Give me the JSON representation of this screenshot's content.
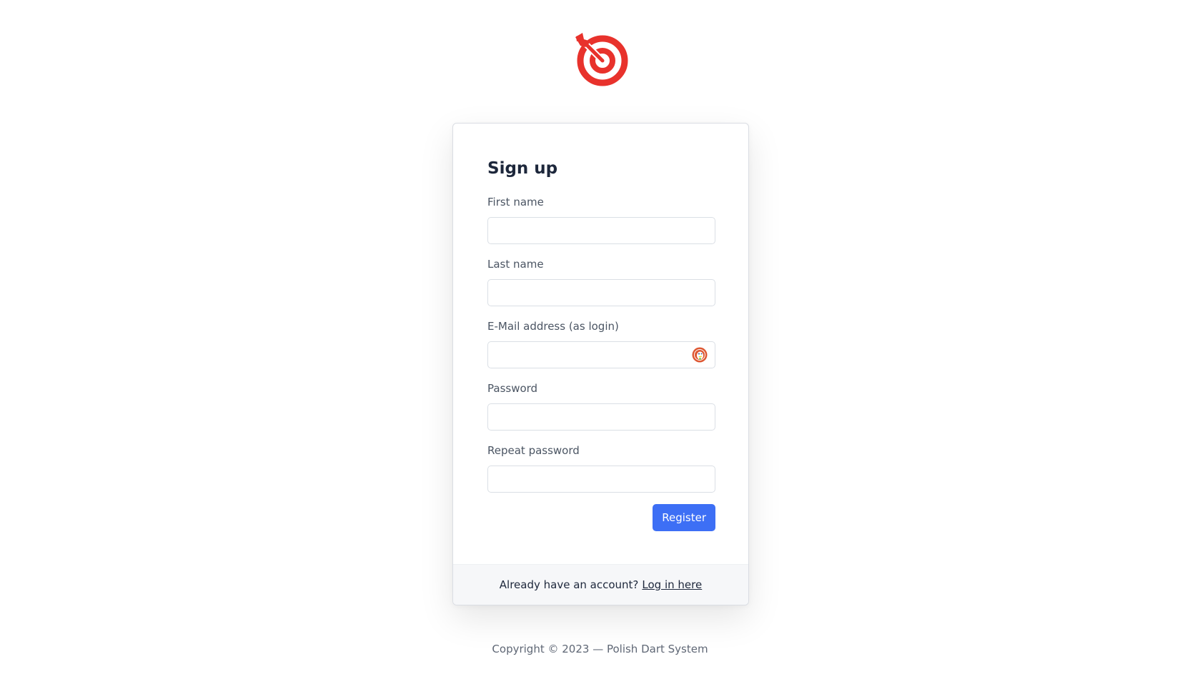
{
  "brand": {
    "logo_icon": "dart-target-icon",
    "accent_color": "#e8322c"
  },
  "form": {
    "title": "Sign up",
    "fields": [
      {
        "label": "First name",
        "value": "",
        "placeholder": ""
      },
      {
        "label": "Last name",
        "value": "",
        "placeholder": ""
      },
      {
        "label": "E-Mail address (as login)",
        "value": "",
        "placeholder": "",
        "autofill_icon": "duckduckgo-icon"
      },
      {
        "label": "Password",
        "value": "",
        "placeholder": ""
      },
      {
        "label": "Repeat password",
        "value": "",
        "placeholder": ""
      }
    ],
    "submit_label": "Register",
    "submit_color": "#3d6ff5"
  },
  "footer": {
    "prompt": "Already have an account?",
    "login_link": "Log in here"
  },
  "copyright": "Copyright © 2023 — Polish Dart System"
}
